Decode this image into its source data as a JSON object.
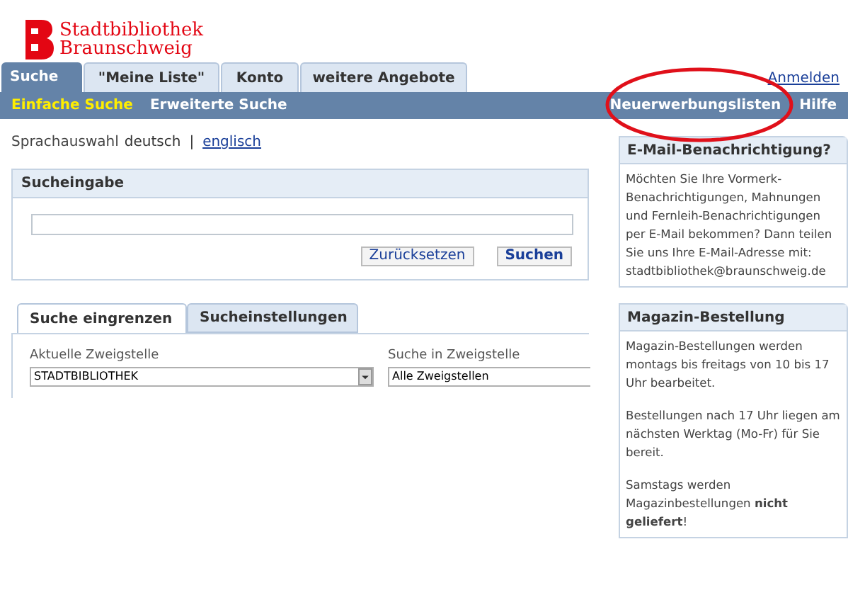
{
  "logo": {
    "lines": [
      "Stadtbibliothek",
      "Braunschweig"
    ]
  },
  "main_tabs": [
    {
      "label": "Suche",
      "selected": true
    },
    {
      "label": "\"Meine Liste\"",
      "selected": false
    },
    {
      "label": "Konto",
      "selected": false
    },
    {
      "label": "weitere Angebote",
      "selected": false
    }
  ],
  "login_link": "Anmelden",
  "sub_nav": [
    {
      "label": "Einfache Suche",
      "selected": true
    },
    {
      "label": "Erweiterte Suche",
      "selected": false
    }
  ],
  "right_nav": [
    "Neuerwerbungslisten",
    "Hilfe"
  ],
  "language": {
    "label": "Sprachauswahl",
    "current": "deutsch",
    "separator": "|",
    "other": "englisch"
  },
  "search_panel": {
    "title": "Sucheingabe",
    "buttons": [
      "Zurücksetzen",
      "Suchen"
    ]
  },
  "filter_tabs": [
    {
      "label": "Suche eingrenzen",
      "selected": true
    },
    {
      "label": "Sucheinstellungen",
      "selected": false
    }
  ],
  "filters": [
    {
      "label": "Aktuelle Zweigstelle",
      "value": "STADTBIBLIOTHEK"
    },
    {
      "label": "Suche in Zweigstelle",
      "value": "Alle Zweigstellen"
    }
  ],
  "side_boxes": [
    {
      "title": "E-Mail-Benachrichtigung?",
      "paragraphs": [
        "Möchten Sie Ihre Vormerk-Benachrichtigungen, Mahnungen und Fernleih-Benachrichtigungen per E-Mail bekommen? Dann teilen Sie uns Ihre E-Mail-Adresse mit: stadtbibliothek@braunschweig.de"
      ]
    },
    {
      "title": "Magazin-Bestellung",
      "paragraphs": [
        "Magazin-Bestellungen werden montags bis freitags von 10 bis 17 Uhr bearbeitet.",
        "Bestellungen nach 17 Uhr liegen am nächsten Werktag (Mo-Fr) für Sie bereit.",
        "Samstags werden Magazinbestellungen **nicht geliefert**!"
      ]
    }
  ]
}
